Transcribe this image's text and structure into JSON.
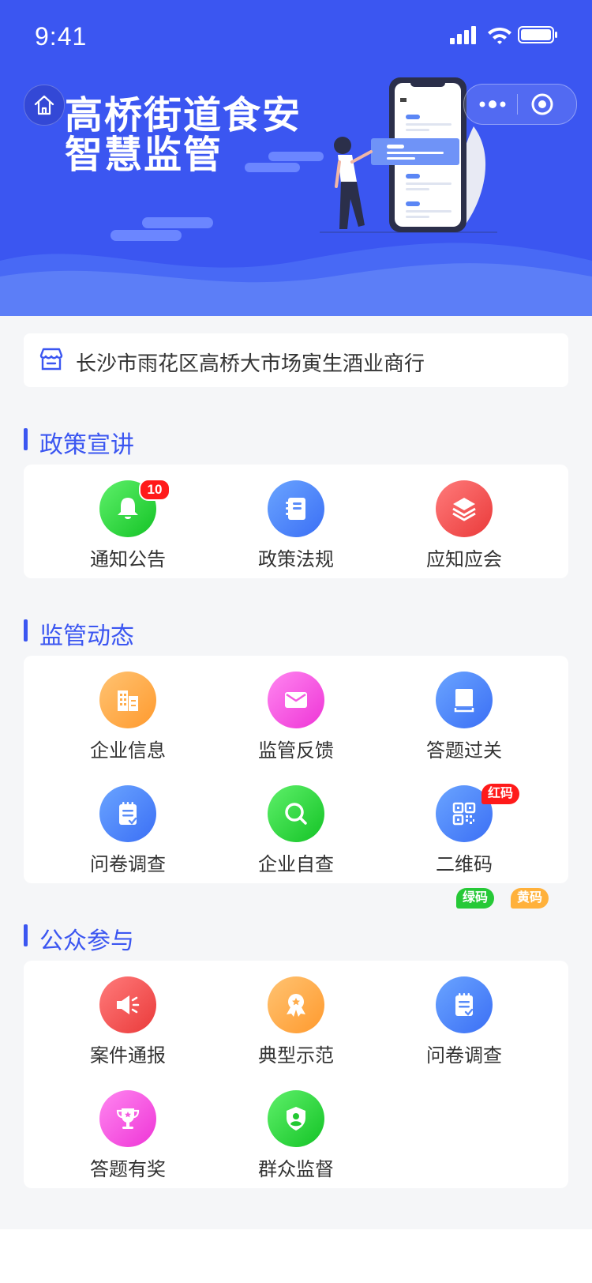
{
  "status_bar": {
    "time": "9:41"
  },
  "header": {
    "title_line1": "高桥街道食安",
    "title_line2": "智慧监管",
    "brand_color": "#3b56f1"
  },
  "address": {
    "text": "长沙市雨花区高桥大市场寅生酒业商行",
    "icon": "store-icon"
  },
  "sections": [
    {
      "title": "政策宣讲",
      "items": [
        {
          "label": "通知公告",
          "icon": "bell-icon",
          "color": "green",
          "badge": "10"
        },
        {
          "label": "政策法规",
          "icon": "notebook-icon",
          "color": "blue"
        },
        {
          "label": "应知应会",
          "icon": "layers-icon",
          "color": "red"
        }
      ]
    },
    {
      "title": "监管动态",
      "items": [
        {
          "label": "企业信息",
          "icon": "building-icon",
          "color": "orange"
        },
        {
          "label": "监管反馈",
          "icon": "mail-icon",
          "color": "pink"
        },
        {
          "label": "答题过关",
          "icon": "book-icon",
          "color": "blue"
        },
        {
          "label": "问卷调查",
          "icon": "clipboard-icon",
          "color": "blue"
        },
        {
          "label": "企业自查",
          "icon": "search-icon",
          "color": "green"
        },
        {
          "label": "二维码",
          "icon": "qrcode-icon",
          "color": "blue",
          "tags": [
            "红码",
            "绿码",
            "黄码"
          ]
        }
      ]
    },
    {
      "title": "公众参与",
      "items": [
        {
          "label": "案件通报",
          "icon": "megaphone-icon",
          "color": "red"
        },
        {
          "label": "典型示范",
          "icon": "award-icon",
          "color": "orange"
        },
        {
          "label": "问卷调查",
          "icon": "clipboard-icon",
          "color": "blue"
        },
        {
          "label": "答题有奖",
          "icon": "trophy-icon",
          "color": "pink"
        },
        {
          "label": "群众监督",
          "icon": "shield-user-icon",
          "color": "green"
        }
      ]
    }
  ]
}
